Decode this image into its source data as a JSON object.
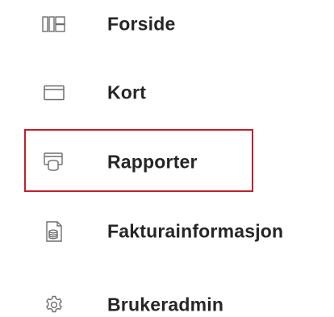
{
  "menu": {
    "items": [
      {
        "label": "Forside",
        "icon": "grid-layout-icon",
        "selected": false
      },
      {
        "label": "Kort",
        "icon": "card-icon",
        "selected": false
      },
      {
        "label": "Rapporter",
        "icon": "report-coins-icon",
        "selected": true
      },
      {
        "label": "Fakturainformasjon",
        "icon": "invoice-document-icon",
        "selected": false
      },
      {
        "label": "Brukeradmin",
        "icon": "gear-icon",
        "selected": false
      }
    ]
  },
  "colors": {
    "text": "#262626",
    "icon": "#6e6e6e",
    "highlight_border": "#c0202b"
  }
}
